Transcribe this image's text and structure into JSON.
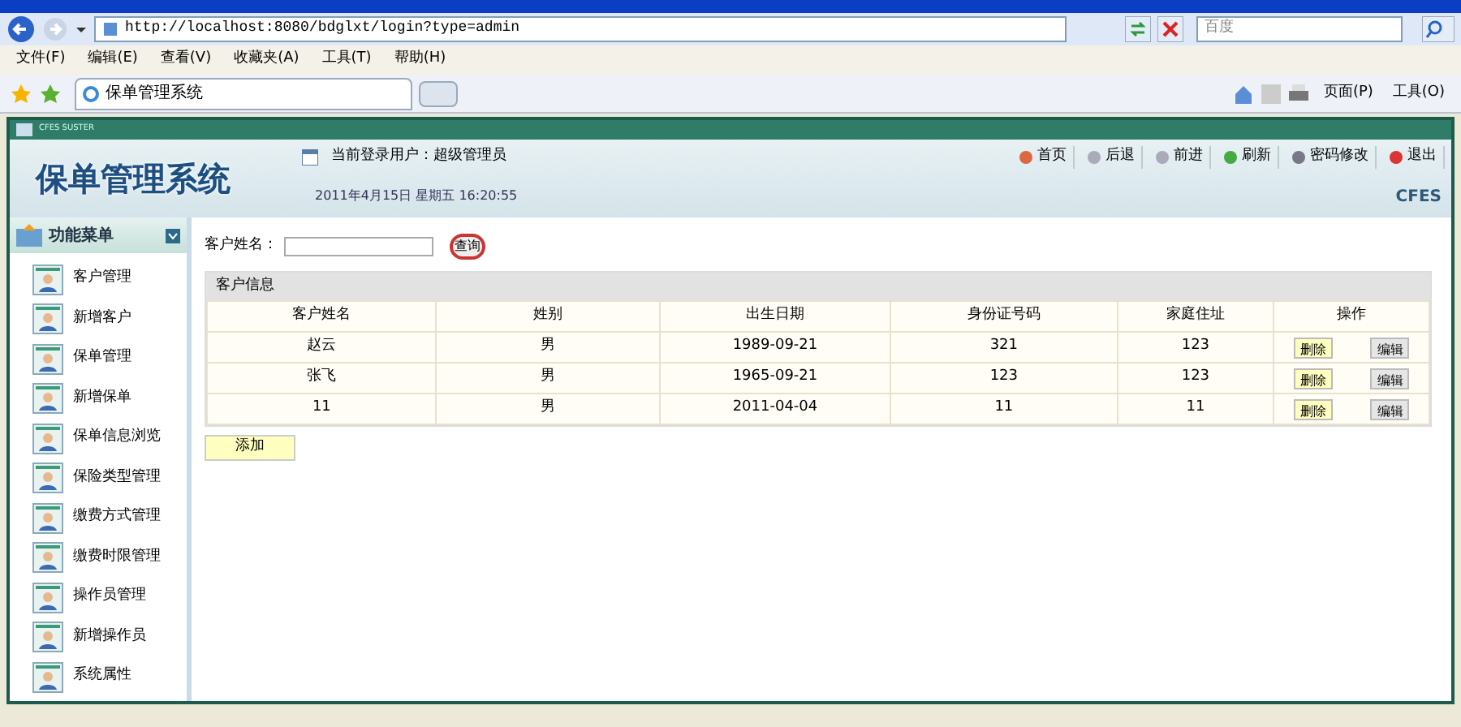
{
  "browser": {
    "address": "http://localhost:8080/bdglxt/login?type=admin",
    "search_placeholder": "百度",
    "menu": [
      "文件(F)",
      "编辑(E)",
      "查看(V)",
      "收藏夹(A)",
      "工具(T)",
      "帮助(H)"
    ],
    "tab": "保单管理系统",
    "tools": [
      "页面(P)",
      "工具(O)"
    ]
  },
  "app": {
    "frame_title": "CFES SUSTER",
    "logo": "保单管理系统",
    "user": "当前登录用户：超级管理员",
    "datetime": "2011年4月15日  星期五  16:20:55",
    "brand": "CFES",
    "nav": [
      "首页",
      "后退",
      "前进",
      "刷新",
      "密码修改",
      "退出"
    ]
  },
  "sidebar": {
    "title": "功能菜单",
    "items": [
      "客户管理",
      "新增客户",
      "保单管理",
      "新增保单",
      "保单信息浏览",
      "保险类型管理",
      "缴费方式管理",
      "缴费时限管理",
      "操作员管理",
      "新增操作员",
      "系统属性"
    ]
  },
  "search": {
    "label": "客户姓名：",
    "button": "查询"
  },
  "table": {
    "caption": "客户信息",
    "columns": [
      "客户姓名",
      "姓别",
      "出生日期",
      "身份证号码",
      "家庭住址",
      "操作"
    ],
    "rows": [
      {
        "cells": [
          "赵云",
          "男",
          "1989-09-21",
          "321",
          "123"
        ],
        "actions": [
          "删除",
          "编辑"
        ]
      },
      {
        "cells": [
          "张飞",
          "男",
          "1965-09-21",
          "123",
          "123"
        ],
        "actions": [
          "删除",
          "编辑"
        ]
      },
      {
        "cells": [
          "11",
          "男",
          "2011-04-04",
          "11",
          "11"
        ],
        "actions": [
          "删除",
          "编辑"
        ]
      }
    ]
  },
  "add_button": "添加"
}
